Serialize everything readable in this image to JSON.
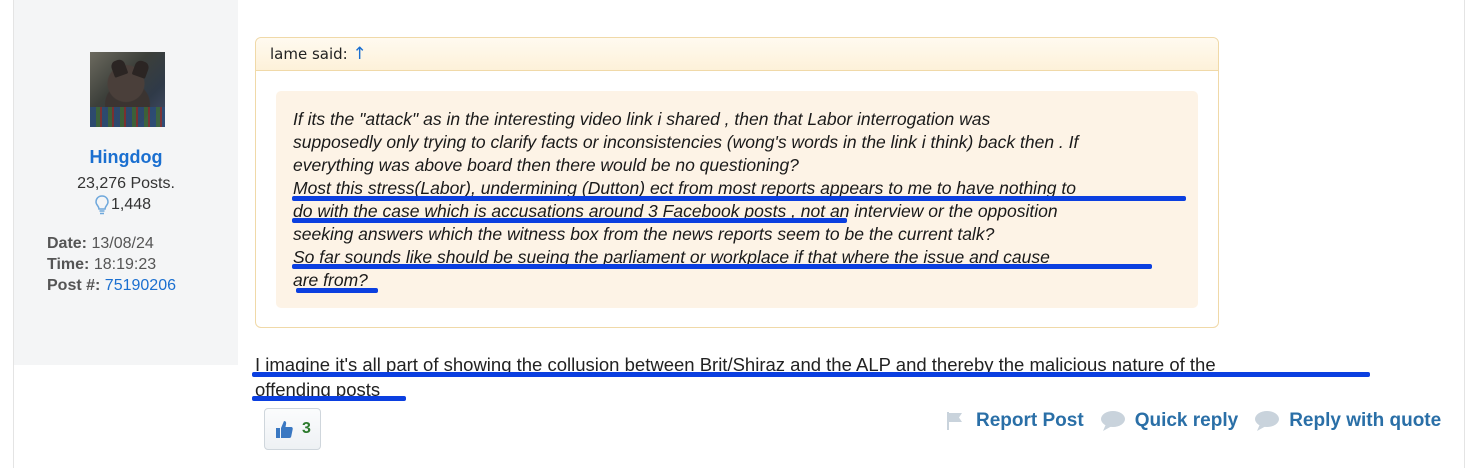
{
  "user": {
    "name": "Hingdog",
    "posts": "23,276 Posts.",
    "likes": "1,448",
    "date_label": "Date:",
    "date": "13/08/24",
    "time_label": "Time:",
    "time": "18:19:23",
    "post_label": "Post #:",
    "post_number": "75190206"
  },
  "quote": {
    "author_label": "lame said:",
    "arrow": "↑",
    "lines": [
      "If its the \"attack\" as in the interesting video link i shared , then that Labor interrogation was",
      "supposedly only trying to clarify facts or inconsistencies (wong's words in the link i think) back then . If",
      "everything was above board then there would be no questioning?",
      "Most this stress(Labor), undermining (Dutton) ect from most reports appears to me to have nothing to",
      "do with the case which is accusations around 3 Facebook posts , not an interview or the opposition",
      "seeking answers which the witness box from the news reports seem to be the current talk?",
      "So far sounds like should be sueing the parliament or workplace if that where the issue and cause",
      "are from?"
    ]
  },
  "reply": {
    "line1": "I imagine it's all part of showing the collusion between Brit/Shiraz and the ALP and thereby the malicious nature of the",
    "line2": "offending posts"
  },
  "like_button": {
    "count": "3"
  },
  "actions": {
    "report": "Report Post",
    "quick_reply": "Quick reply",
    "reply_quote": "Reply with quote"
  },
  "colors": {
    "link": "#1a6fd0",
    "action": "#2a6fa7",
    "annotation": "#0b3fe0"
  }
}
